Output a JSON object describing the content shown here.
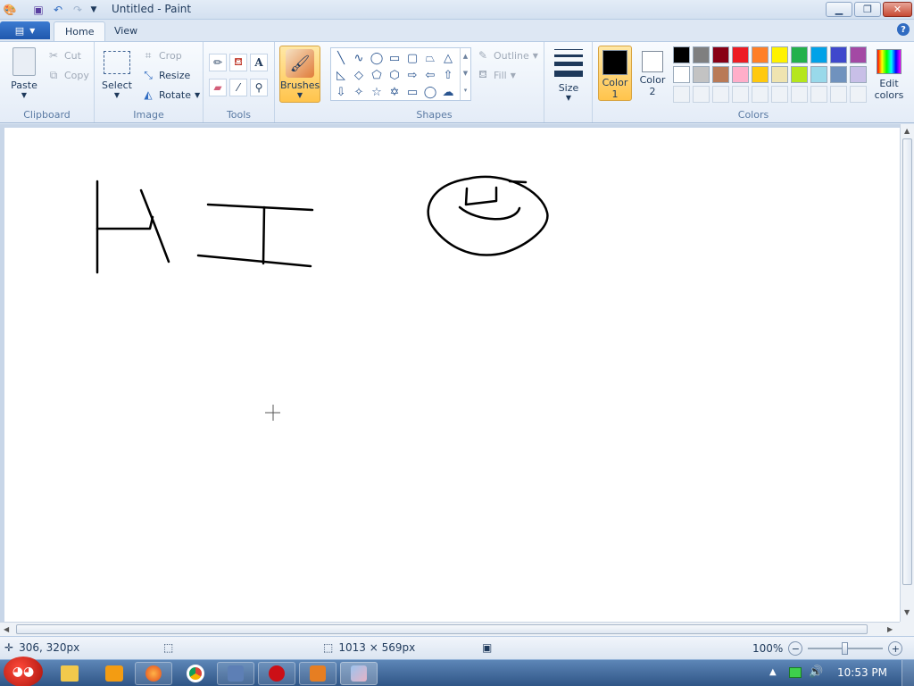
{
  "window": {
    "title": "Untitled - Paint",
    "minimize_icon": "minimize-icon",
    "maximize_icon": "restore-icon",
    "close_icon": "close-icon"
  },
  "quick_access": [
    "save-icon",
    "undo-icon",
    "redo-icon",
    "customize-dropdown-icon"
  ],
  "tabs": [
    {
      "label": "Home",
      "active": true
    },
    {
      "label": "View",
      "active": false
    }
  ],
  "ribbon": {
    "clipboard": {
      "label": "Clipboard",
      "paste": "Paste",
      "cut": "Cut",
      "copy": "Copy"
    },
    "image": {
      "label": "Image",
      "select": "Select",
      "crop": "Crop",
      "resize": "Resize",
      "rotate": "Rotate"
    },
    "tools": {
      "label": "Tools"
    },
    "brushes": {
      "label": "Brushes"
    },
    "shapes": {
      "label": "Shapes",
      "outline": "Outline",
      "fill": "Fill"
    },
    "size": {
      "label": "Size"
    },
    "colors": {
      "label": "Colors",
      "color1_line1": "Color",
      "color1_line2": "1",
      "color2_line1": "Color",
      "color2_line2": "2",
      "edit_line1": "Edit",
      "edit_line2": "colors",
      "color1": "#000000",
      "color2": "#ffffff",
      "palette_row1": [
        "#000000",
        "#7f7f7f",
        "#880015",
        "#ed1c24",
        "#ff7f27",
        "#fff200",
        "#22b14c",
        "#00a2e8",
        "#3f48cc",
        "#a349a4"
      ],
      "palette_row2": [
        "#ffffff",
        "#c3c3c3",
        "#b97a57",
        "#ffaec9",
        "#ffc90e",
        "#efe4b0",
        "#b5e61d",
        "#99d9ea",
        "#7092be",
        "#c8bfe7"
      ]
    }
  },
  "status": {
    "cursor_pos": "306, 320px",
    "canvas_size": "1013 × 569px",
    "zoom": "100%"
  },
  "taskbar": {
    "time": "10:53 PM"
  }
}
